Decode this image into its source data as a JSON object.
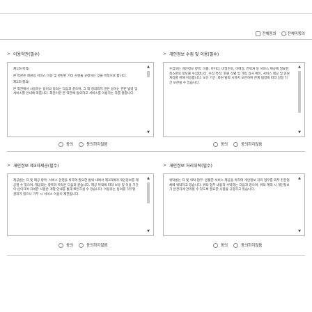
{
  "top_actions": {
    "agree_all_label": "전체동의",
    "disagree_all_label": "전체미동의"
  },
  "sections": [
    {
      "title": "이용약관(필수)",
      "paragraphs": [
        "제1조(목적)",
        "본 약관은 회원의 서비스 이용 및 관련된 기타 사항을 규정하는 것을 목적으로 합니다.",
        "제2조(정의)",
        "본 약관에서 사용하는 용어의 정의는 다음과 같으며, 그 외 정의되지 않은 용어는 관련 법령 및 서비스별 안내에 따릅니다. 회원이란 본 약관에 동의하고 서비스를 이용하는 자를 말합니다."
      ],
      "agree_label": "동의",
      "disagree_label": "동의하지않음"
    },
    {
      "title": "개인정보 수집 및 이용(필수)",
      "paragraphs": [
        "수집하는 개인정보 항목: 이름, 아이디, 비밀번호, 이메일, 연락처 등 서비스 제공에 필요한 최소한의 정보를 수집합니다. 수집 목적: 회원 식별 및 가입 의사 확인, 서비스 제공 및 민원 처리를 위해 이용합니다. 보유 기간: 회원 탈퇴 시까지 보관하며 관계 법령에 따라 일정 기간 보관될 수 있습니다."
      ],
      "agree_label": "동의",
      "disagree_label": "동의하지않음"
    },
    {
      "title": "개인정보 제3자제공(필수)",
      "paragraphs": [
        "제공받는 자 및 제공 항목: 서비스 운영을 위하여 필요한 범위 내에서 제3자에게 개인정보를 제공할 수 있으며, 제공되는 항목과 목적은 다음과 같습니다. 제공 목적에 따라 보유 및 이용 기간이 상이하며 자세한 사항은 개별 안내를 통해 확인하실 수 있습니다. 이용자는 동의를 거부할 권리가 있으나 거부 시 서비스 이용이 제한됩니다."
      ],
      "agree_label": "동의",
      "disagree_label": "동의하지않음"
    },
    {
      "title": "개인정보 처리위탁(필수)",
      "paragraphs": [
        "위탁받는 자 및 위탁 업무: 원활한 서비스 제공을 위하여 개인정보 처리 업무를 외부 전문업체에 위탁하고 있습니다. 위탁 업무 내용과 수탁자는 다음과 같으며, 위탁 계약 시 개인정보가 안전하게 관리될 수 있도록 필요한 사항을 규정하고 있습니다."
      ],
      "agree_label": "동의",
      "disagree_label": "동의하지않음"
    }
  ]
}
